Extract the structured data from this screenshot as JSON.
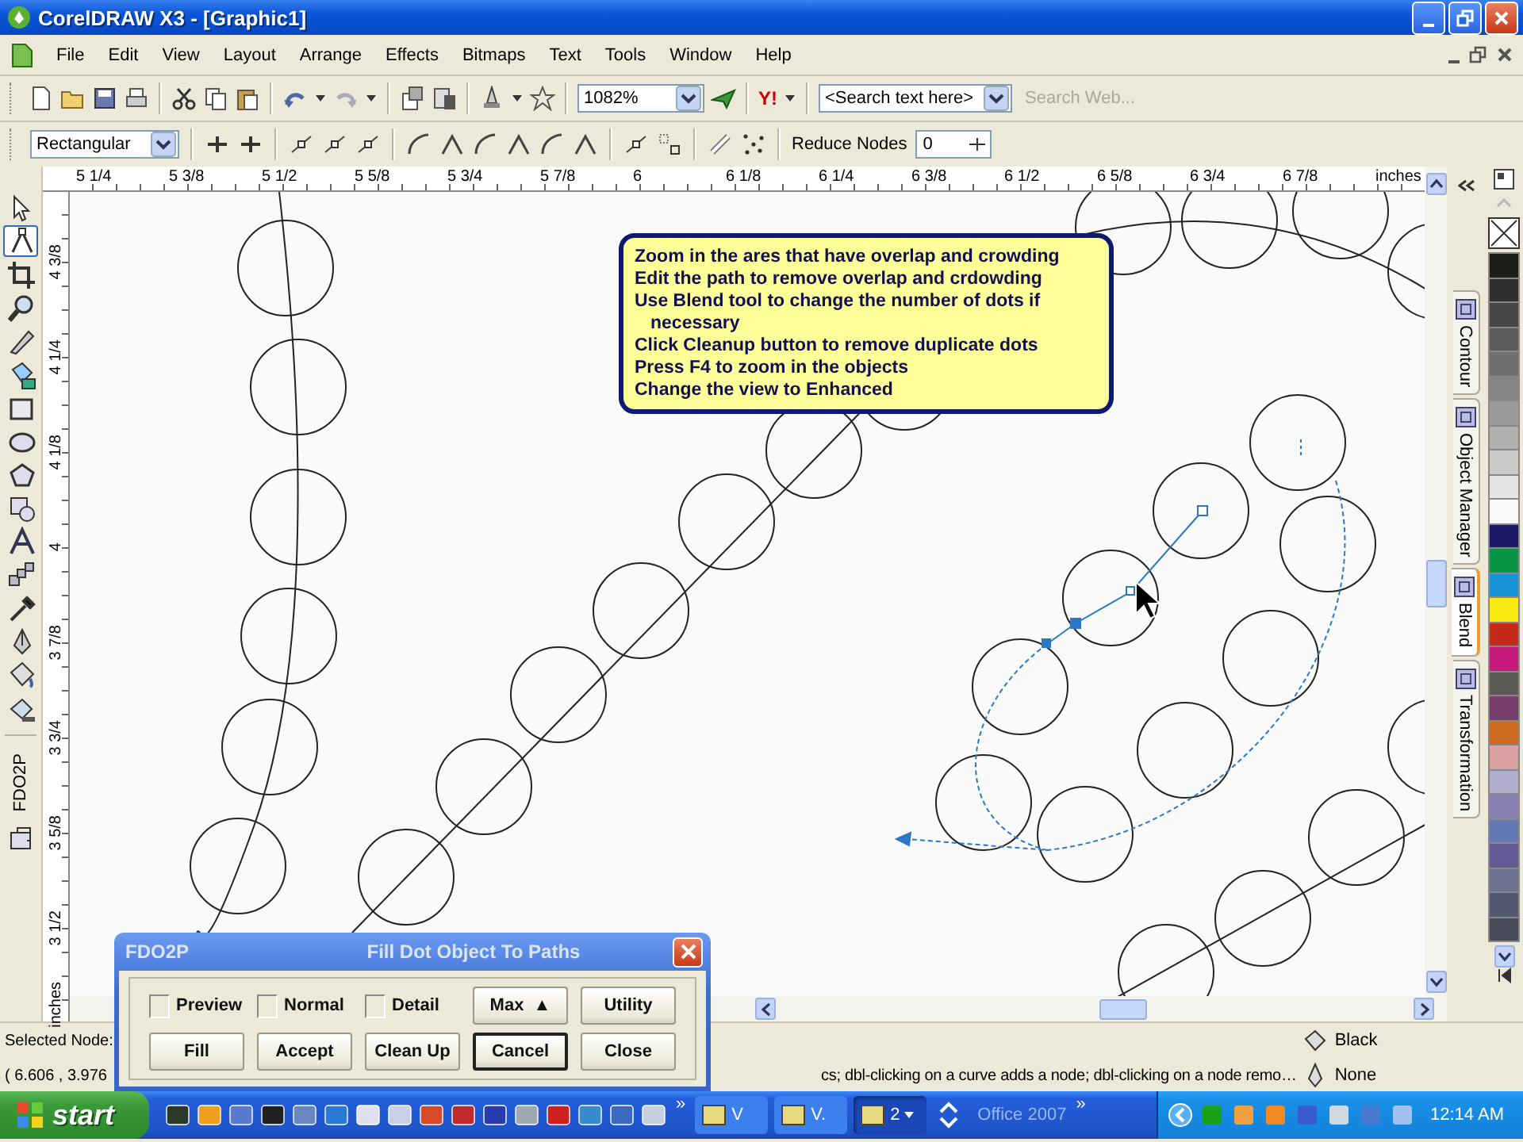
{
  "window": {
    "title": "CorelDRAW X3 - [Graphic1]"
  },
  "menu": [
    "File",
    "Edit",
    "View",
    "Layout",
    "Arrange",
    "Effects",
    "Bitmaps",
    "Text",
    "Tools",
    "Window",
    "Help"
  ],
  "standard_toolbar": {
    "zoom": "1082%",
    "yahoo_logo": "Y!",
    "search": "<Search text here>",
    "search_web": {
      "label": "Search Web...",
      "disabled": true
    }
  },
  "property_bar": {
    "selection_mode": "Rectangular",
    "reduce_nodes_label": "Reduce Nodes",
    "reduce_nodes_value": "0"
  },
  "toolbox": [
    {
      "kind": "pick",
      "selected": false
    },
    {
      "kind": "shape",
      "selected": true
    },
    {
      "kind": "crop",
      "selected": false
    },
    {
      "kind": "zoom",
      "selected": false
    },
    {
      "kind": "pen",
      "selected": false
    },
    {
      "kind": "smartfill",
      "selected": false
    },
    {
      "kind": "rectangle",
      "selected": false
    },
    {
      "kind": "ellipse",
      "selected": false
    },
    {
      "kind": "polygon",
      "selected": false
    },
    {
      "kind": "shapes",
      "selected": false
    },
    {
      "kind": "text",
      "selected": false
    },
    {
      "kind": "blend",
      "selected": false
    },
    {
      "kind": "eyedropper",
      "selected": false
    },
    {
      "kind": "outline",
      "selected": false
    },
    {
      "kind": "fill",
      "selected": false
    },
    {
      "kind": "interactivefill",
      "selected": false
    }
  ],
  "fdo2p_toolbar": {
    "label": "FDO2P"
  },
  "rulers": {
    "horizontal": [
      "5 1/4",
      "5 3/8",
      "5 1/2",
      "5 5/8",
      "5 3/4",
      "5 7/8",
      "6",
      "6 1/8",
      "6 1/4",
      "6 3/8",
      "6 1/2",
      "6 5/8",
      "6 3/4",
      "6 7/8",
      "inches"
    ],
    "vertical": [
      "4 3/8",
      "4 1/4",
      "4 1/8",
      "4",
      "3 7/8",
      "3 3/4",
      "3 5/8",
      "3 1/2",
      "inches"
    ]
  },
  "callout": {
    "lines": [
      {
        "text": "Zoom in the ares that have overlap and crowding",
        "kind": "step"
      },
      {
        "text": "Edit the path to remove overlap and crdowding",
        "kind": "step"
      },
      {
        "text": "Use Blend tool to change the number of dots if",
        "kind": "step"
      },
      {
        "text": "necessary",
        "kind": "continuation"
      },
      {
        "text": "Click Cleanup button to remove duplicate dots",
        "kind": "step"
      },
      {
        "text": "Press F4 to zoom in the objects",
        "kind": "step"
      },
      {
        "text": "Change the view to Enhanced",
        "kind": "step"
      }
    ]
  },
  "dockers": [
    {
      "label": "Contour",
      "selected": false
    },
    {
      "label": "Object Manager",
      "selected": false
    },
    {
      "label": "Blend",
      "selected": true
    },
    {
      "label": "Transformation",
      "selected": false
    }
  ],
  "palette": [
    {
      "color": "#1c1e1a"
    },
    {
      "color": "#303030"
    },
    {
      "color": "#464646"
    },
    {
      "color": "#5c5c5c"
    },
    {
      "color": "#707070"
    },
    {
      "color": "#858585"
    },
    {
      "color": "#9a9a9a"
    },
    {
      "color": "#b0b0ae"
    },
    {
      "color": "#cacac8"
    },
    {
      "color": "#e4e4e4"
    },
    {
      "color": "#f8f8f8"
    },
    {
      "color": "#1e1a6a"
    },
    {
      "color": "#0a9444"
    },
    {
      "color": "#1a94d8"
    },
    {
      "color": "#f8ea10"
    },
    {
      "color": "#c42a1a"
    },
    {
      "color": "#c4197a"
    },
    {
      "color": "#5a5a52"
    },
    {
      "color": "#7a3e6c"
    },
    {
      "color": "#cc6a1e"
    },
    {
      "color": "#d8a0a0"
    },
    {
      "color": "#b0aecc"
    },
    {
      "color": "#8880b0"
    },
    {
      "color": "#6478b4"
    },
    {
      "color": "#665a96"
    },
    {
      "color": "#6c7290"
    },
    {
      "color": "#505870"
    },
    {
      "color": "#484c58"
    }
  ],
  "status_bar": {
    "selected_node": "Selected Node:",
    "coordinates": "( 6.606 , 3.976",
    "hint": "cs; dbl-clicking on a curve adds a node; dbl-clicking on a node remo…",
    "fill": "Black",
    "outline": "None"
  },
  "dialog": {
    "app": "FDO2P",
    "title": "Fill Dot Object To Paths",
    "toggles": [
      {
        "label": "Preview",
        "checked": false
      },
      {
        "label": "Normal",
        "checked": false
      },
      {
        "label": "Detail",
        "checked": false
      }
    ],
    "buttons": [
      {
        "label": "Max",
        "glyph": "▲",
        "default": false
      },
      {
        "label": "Utility",
        "default": false
      },
      {
        "label": "Fill",
        "default": false
      },
      {
        "label": "Accept",
        "default": false
      },
      {
        "label": "Clean Up",
        "default": false
      },
      {
        "label": "Cancel",
        "default": true
      },
      {
        "label": "Close",
        "default": false
      }
    ]
  },
  "taskbar": {
    "start": "start",
    "quick_launch_more": "»",
    "tasks": [
      {
        "label": "V",
        "selected": false
      },
      {
        "label": "V.",
        "selected": false
      },
      {
        "label": "2",
        "selected": true
      }
    ],
    "toolbar_name": "Office 2007",
    "toolbar_more": "»",
    "clock": "12:14 AM"
  }
}
